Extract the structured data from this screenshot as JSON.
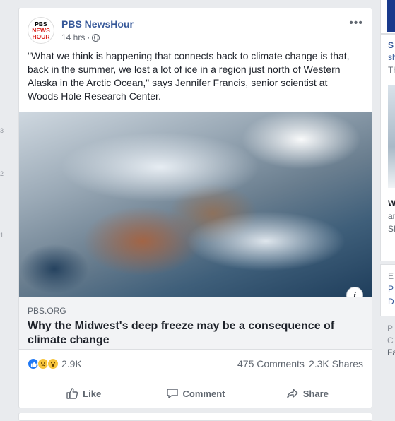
{
  "left_ticks": [
    "3",
    "2",
    "1"
  ],
  "post": {
    "page_name": "PBS NewsHour",
    "logo_lines": [
      "PBS",
      "NEWS",
      "HOUR"
    ],
    "timestamp": "14 hrs",
    "separator": "·",
    "more_label": "•••",
    "text": "\"What we think is happening that connects back to climate change is that, back in the summer, we lost a lot of ice in a region just north of Western Alaska in the Arctic Ocean,\" says Jennifer Francis, senior scientist at Woods Hole Research Center.",
    "info_label": "i",
    "link": {
      "domain": "PBS.ORG",
      "title": "Why the Midwest's deep freeze may be a consequence of climate change"
    },
    "stats": {
      "reactions_count": "2.9K",
      "comments": "475 Comments",
      "shares": "2.3K Shares"
    },
    "actions": {
      "like": "Like",
      "comment": "Comment",
      "share": "Share"
    }
  },
  "right_column": {
    "snippets": [
      "S",
      "sh",
      "Th",
      "W",
      "an",
      "Sl",
      "E",
      "P",
      "D",
      "P",
      "C",
      "Fa"
    ]
  }
}
